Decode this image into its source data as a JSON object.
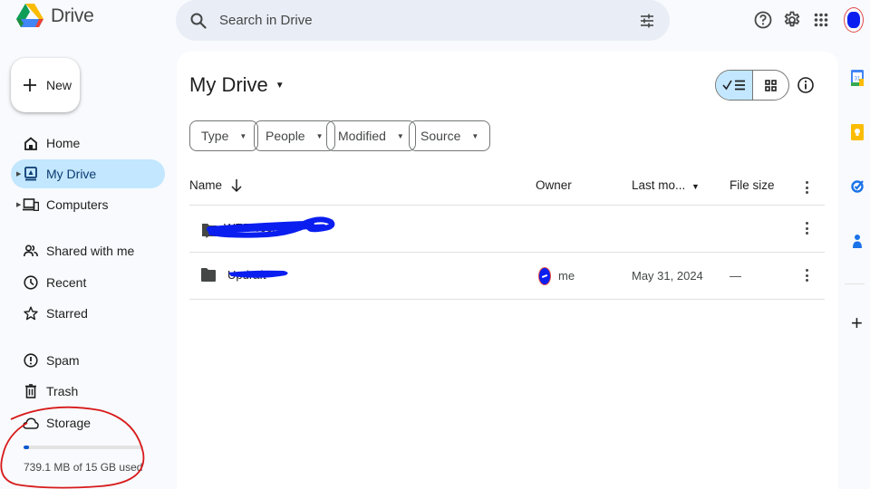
{
  "app": {
    "name": "Drive",
    "logo_icon": "google-drive-logo"
  },
  "header": {
    "search_placeholder": "Search in Drive",
    "search_icon": "search-icon",
    "filter_icon": "search-options-icon",
    "help_icon": "help-icon",
    "settings_icon": "settings-gear-icon",
    "apps_icon": "apps-grid-icon",
    "account_icon": "account-avatar"
  },
  "sidebar": {
    "new_button": "New",
    "items": [
      {
        "label": "Home",
        "icon": "home-icon",
        "active": false,
        "expandable": false
      },
      {
        "label": "My Drive",
        "icon": "my-drive-icon",
        "active": true,
        "expandable": true
      },
      {
        "label": "Computers",
        "icon": "computers-icon",
        "active": false,
        "expandable": true
      },
      {
        "label": "Shared with me",
        "icon": "shared-people-icon",
        "active": false,
        "expandable": false
      },
      {
        "label": "Recent",
        "icon": "clock-icon",
        "active": false,
        "expandable": false
      },
      {
        "label": "Starred",
        "icon": "star-icon",
        "active": false,
        "expandable": false
      },
      {
        "label": "Spam",
        "icon": "spam-icon",
        "active": false,
        "expandable": false
      },
      {
        "label": "Trash",
        "icon": "trash-icon",
        "active": false,
        "expandable": false
      },
      {
        "label": "Storage",
        "icon": "cloud-icon",
        "active": false,
        "expandable": false
      }
    ],
    "storage": {
      "used_text": "739.1 MB of 15 GB used",
      "used_fraction": 0.048,
      "annotation": "red hand-drawn circle"
    }
  },
  "main": {
    "title": "My Drive",
    "filters": [
      "Type",
      "People",
      "Modified",
      "Source"
    ],
    "view": {
      "list_selected": true,
      "list_icon": "check-list-view-icon",
      "grid_icon": "grid-view-icon",
      "info_icon": "info-icon"
    },
    "columns": {
      "name": "Name",
      "name_sort": "descending-arrow",
      "owner": "Owner",
      "last_modified": "Last mo...",
      "last_modified_sort": "sort-down-caret",
      "file_size": "File size"
    },
    "rows": [
      {
        "name": "WEB Techn...",
        "redacted": true,
        "icon": "shared-folder-icon",
        "owner": "",
        "last_modified": "",
        "file_size": ""
      },
      {
        "name": "Updraft",
        "redacted": true,
        "icon": "folder-icon",
        "owner": "me",
        "last_modified": "May 31, 2024",
        "file_size": "—"
      }
    ]
  },
  "side_panel": {
    "apps": [
      "calendar-icon",
      "keep-icon",
      "tasks-icon",
      "contacts-icon"
    ],
    "add_label": "+"
  },
  "colors": {
    "accent": "#0b57d0",
    "active_nav": "#c2e7ff",
    "search_bg": "#e9eef6",
    "page_bg": "#f8fafd",
    "redaction": "#0a1ef0",
    "annotation": "#d81a1a"
  }
}
